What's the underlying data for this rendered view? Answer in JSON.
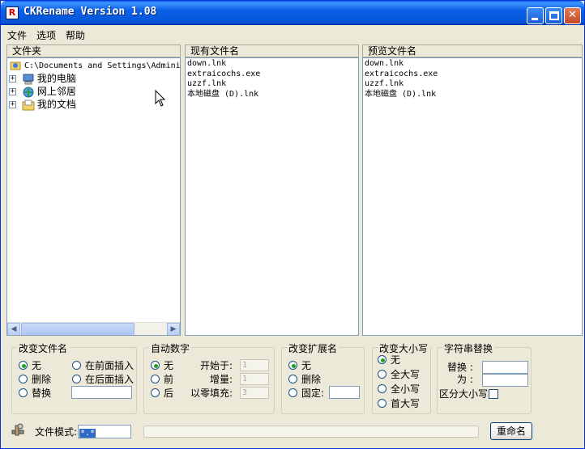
{
  "window": {
    "title": "CKRename Version 1.08"
  },
  "menu": [
    "文件",
    "选项",
    "帮助"
  ],
  "panels": {
    "folder": {
      "header": "文件夹",
      "root_path": "C:\\Documents and Settings\\Admini",
      "items": [
        "我的电脑",
        "网上邻居",
        "我的文档"
      ]
    },
    "current": {
      "header": "现有文件名",
      "files": [
        "down.lnk",
        "extraicochs.exe",
        "uzzf.lnk",
        "本地磁盘 (D).lnk"
      ]
    },
    "preview": {
      "header": "预览文件名",
      "files": [
        "down.lnk",
        "extraicochs.exe",
        "uzzf.lnk",
        "本地磁盘 (D).lnk"
      ]
    }
  },
  "groups": {
    "rename": {
      "title": "改变文件名",
      "options": [
        "无",
        "删除",
        "替换",
        "在前面插入",
        "在后面插入"
      ],
      "selected": "无",
      "replace_value": ""
    },
    "auto_number": {
      "title": "自动数字",
      "options": [
        "无",
        "前",
        "后"
      ],
      "selected": "无",
      "start_label": "开始于:",
      "start_value": "1",
      "step_label": "增量:",
      "step_value": "1",
      "pad_label": "以零填充:",
      "pad_value": "3"
    },
    "extension": {
      "title": "改变扩展名",
      "options": [
        "无",
        "删除",
        "固定:"
      ],
      "selected": "无",
      "fixed_value": ""
    },
    "case": {
      "title": "改变大小写",
      "options": [
        "无",
        "全大写",
        "全小写",
        "首大写"
      ],
      "selected": "无"
    },
    "string_replace": {
      "title": "字符串替换",
      "replace_label": "替换 :",
      "with_label": "为 :",
      "case_label": "区分大小写",
      "replace_value": "",
      "with_value": "",
      "case_sensitive": false
    }
  },
  "bottom": {
    "pattern_label": "文件模式:",
    "pattern_value": "*.*",
    "rename_button": "重命名"
  }
}
